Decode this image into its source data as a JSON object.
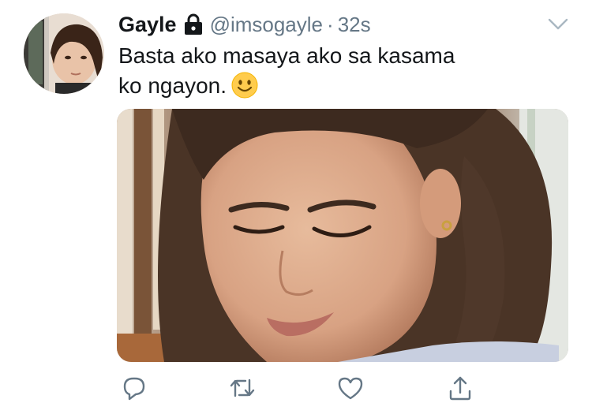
{
  "tweet": {
    "display_name": "Gayle",
    "handle": "@imsogayle",
    "separator": "·",
    "time": "32s",
    "text_line1": "Basta ako masaya ako sa kasama",
    "text_line2": "ko ngayon.",
    "emoji": "slightly-smiling-face"
  },
  "icons": {
    "lock": "lock-icon",
    "caret": "chevron-down-icon",
    "reply": "reply-icon",
    "retweet": "retweet-icon",
    "like": "heart-icon",
    "share": "share-icon"
  },
  "colors": {
    "text": "#14171a",
    "secondary": "#657786",
    "icon": "#657786"
  }
}
